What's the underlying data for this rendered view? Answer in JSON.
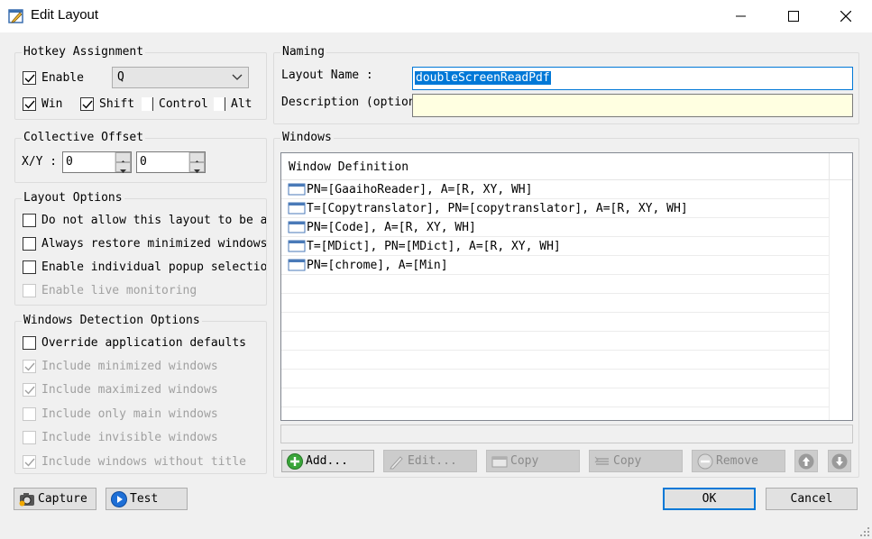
{
  "window": {
    "title": "Edit Layout",
    "icon": "edit-layout-app-icon",
    "controls": [
      "minimize-icon",
      "maximize-icon",
      "close-icon"
    ]
  },
  "hotkey": {
    "group_title": "Hotkey Assignment",
    "enable_label": "Enable",
    "enable_checked": true,
    "key_value": "Q",
    "win_label": "Win",
    "win_checked": true,
    "shift_label": "Shift",
    "shift_checked": true,
    "control_label": "Control",
    "control_checked": false,
    "alt_label": "Alt",
    "alt_checked": false
  },
  "offset": {
    "group_title": "Collective Offset",
    "xy_label": "X/Y :",
    "x_value": "0",
    "y_value": "0"
  },
  "layout_options": {
    "group_title": "Layout Options",
    "items": [
      {
        "label": "Do not allow this layout to be ap",
        "checked": false,
        "disabled": false
      },
      {
        "label": "Always restore minimized windows",
        "checked": false,
        "disabled": false
      },
      {
        "label": "Enable individual popup selection",
        "checked": false,
        "disabled": false
      },
      {
        "label": "Enable live monitoring",
        "checked": false,
        "disabled": true
      }
    ]
  },
  "detection": {
    "group_title": "Windows Detection Options",
    "items": [
      {
        "label": "Override application defaults",
        "checked": false,
        "disabled": false
      },
      {
        "label": "Include minimized windows",
        "checked": true,
        "disabled": true
      },
      {
        "label": "Include maximized windows",
        "checked": true,
        "disabled": true
      },
      {
        "label": "Include only main windows",
        "checked": false,
        "disabled": true
      },
      {
        "label": "Include invisible windows",
        "checked": false,
        "disabled": true
      },
      {
        "label": "Include windows without title",
        "checked": true,
        "disabled": true
      }
    ]
  },
  "naming": {
    "group_title": "Naming",
    "layout_name_label": "Layout Name :",
    "layout_name_value": "doubleScreenReadPdf",
    "description_label": "Description (optional) :",
    "description_value": ""
  },
  "windows": {
    "group_title": "Windows",
    "column_header": "Window Definition",
    "rows": [
      "PN=[GaaihoReader], A=[R, XY, WH]",
      "T=[Copytranslator], PN=[copytranslator], A=[R, XY, WH]",
      "PN=[Code], A=[R, XY, WH]",
      "T=[MDict], PN=[MDict], A=[R, XY, WH]",
      "PN=[chrome], A=[Min]"
    ],
    "buttons": {
      "add": "Add...",
      "edit": "Edit...",
      "copy1": "Copy",
      "copy2": "Copy",
      "remove": "Remove"
    }
  },
  "bottom": {
    "capture": "Capture",
    "test": "Test",
    "ok": "OK",
    "cancel": "Cancel"
  },
  "colors": {
    "accent": "#0078d7",
    "description_bg": "#ffffe1",
    "dialog_bg": "#f0f0f0"
  }
}
